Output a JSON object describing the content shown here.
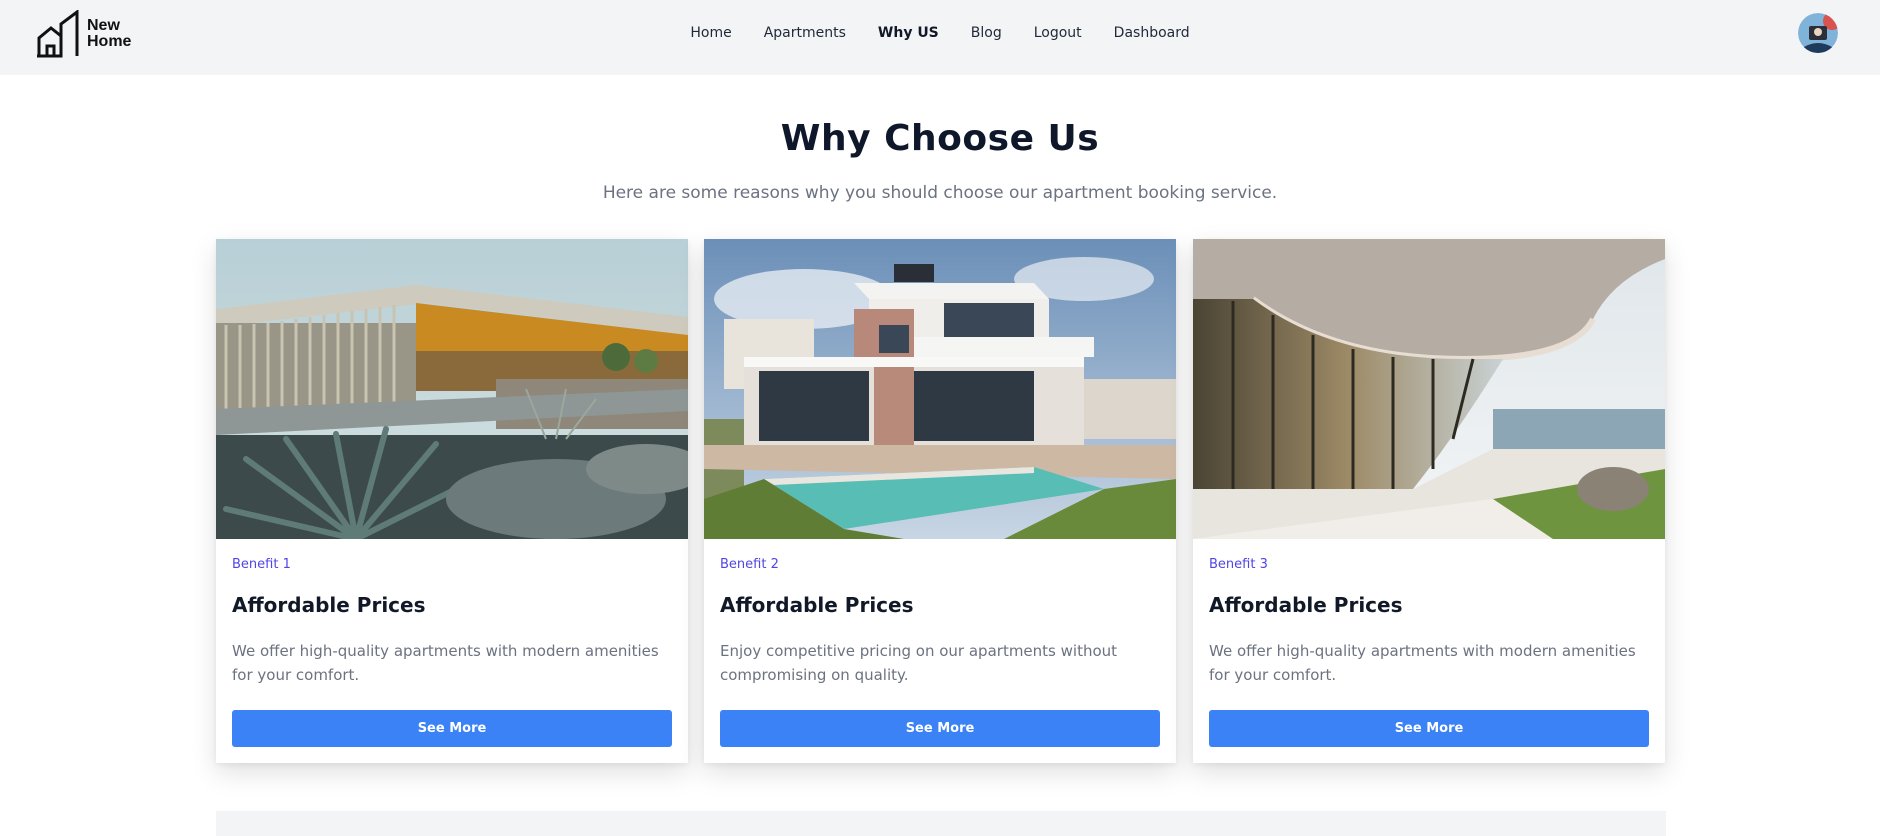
{
  "header": {
    "logo": {
      "line1": "New",
      "line2": "Home"
    },
    "nav": [
      {
        "label": "Home",
        "active": false
      },
      {
        "label": "Apartments",
        "active": false
      },
      {
        "label": "Why US",
        "active": true
      },
      {
        "label": "Blog",
        "active": false
      },
      {
        "label": "Logout",
        "active": false
      },
      {
        "label": "Dashboard",
        "active": false
      }
    ],
    "avatar_icon": "user-avatar"
  },
  "section": {
    "title": "Why Choose Us",
    "subtitle": "Here are some reasons why you should choose our apartment booking service."
  },
  "cards": [
    {
      "tag": "Benefit 1",
      "title": "Affordable Prices",
      "description": "We offer high-quality apartments with modern amenities for your comfort.",
      "button": "See More"
    },
    {
      "tag": "Benefit 2",
      "title": "Affordable Prices",
      "description": "Enjoy competitive pricing on our apartments without compromising on quality.",
      "button": "See More"
    },
    {
      "tag": "Benefit 3",
      "title": "Affordable Prices",
      "description": "We offer high-quality apartments with modern amenities for your comfort.",
      "button": "See More"
    }
  ],
  "colors": {
    "accent": "#3b82f6",
    "tag": "#4f46e5",
    "header_bg": "#f3f4f6"
  }
}
